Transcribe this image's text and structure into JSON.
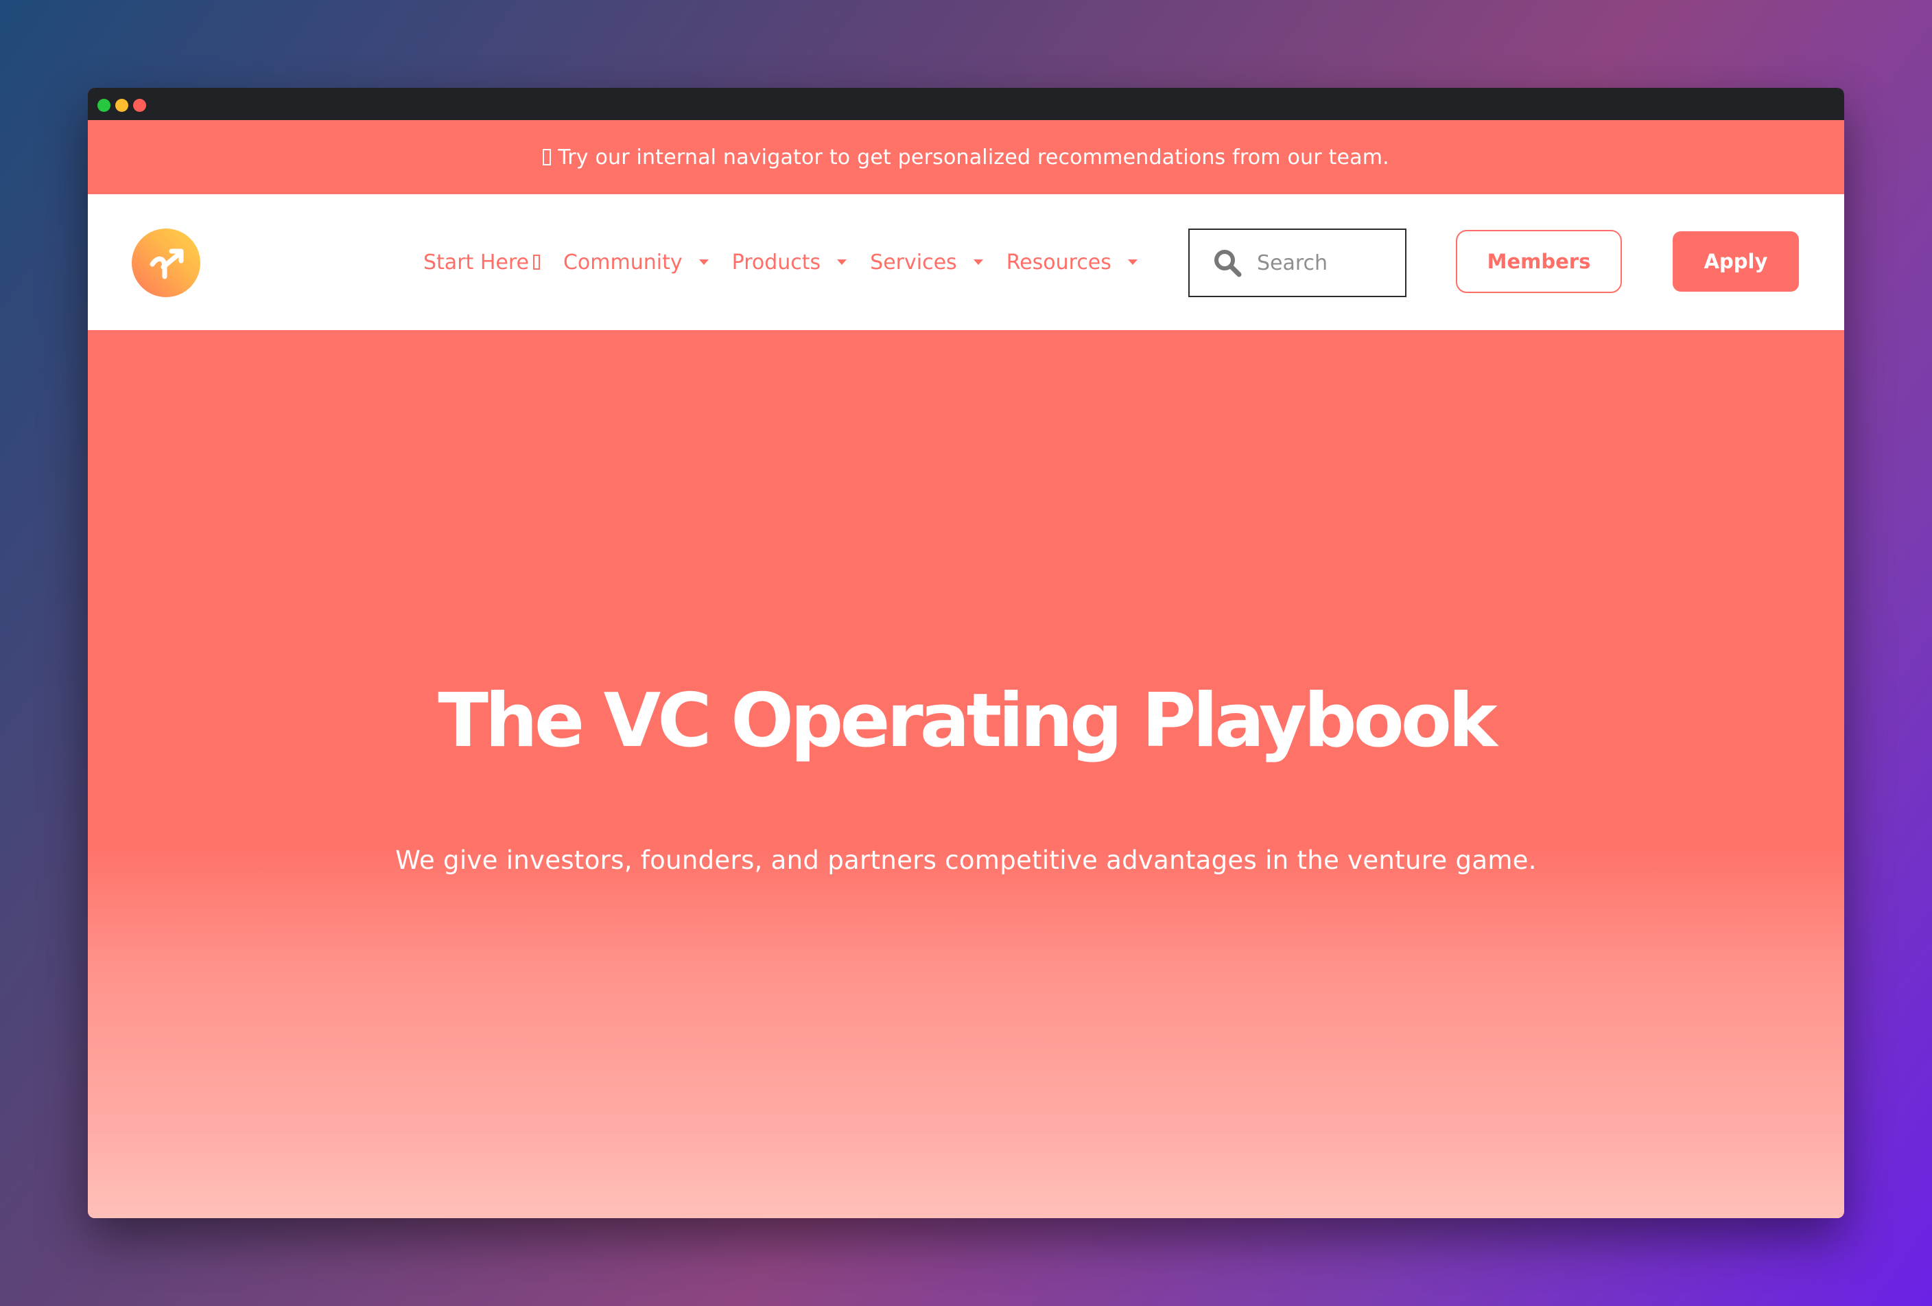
{
  "announcement": {
    "text": "Try our internal navigator to get personalized recommendations from our team.",
    "icon": "unrecognized-glyph-icon"
  },
  "nav": {
    "logo_icon": "merge-arrow-icon",
    "items": [
      {
        "label": "Start Here",
        "icon": "external-glyph-icon"
      },
      {
        "label": "Community",
        "icon": "caret-down-icon"
      },
      {
        "label": "Products",
        "icon": "caret-down-icon"
      },
      {
        "label": "Services",
        "icon": "caret-down-icon"
      },
      {
        "label": "Resources",
        "icon": "caret-down-icon"
      }
    ],
    "search": {
      "placeholder": "Search",
      "value": "",
      "icon": "search-icon"
    },
    "members_label": "Members",
    "apply_label": "Apply"
  },
  "hero": {
    "title": "The VC Operating Playbook",
    "subtitle": "We give investors, founders, and partners competitive advantages in the venture game."
  },
  "colors": {
    "brand": "#ff7268",
    "brand_text": "#ff6f67",
    "nav_background": "#ffffff",
    "titlebar": "#212226"
  }
}
